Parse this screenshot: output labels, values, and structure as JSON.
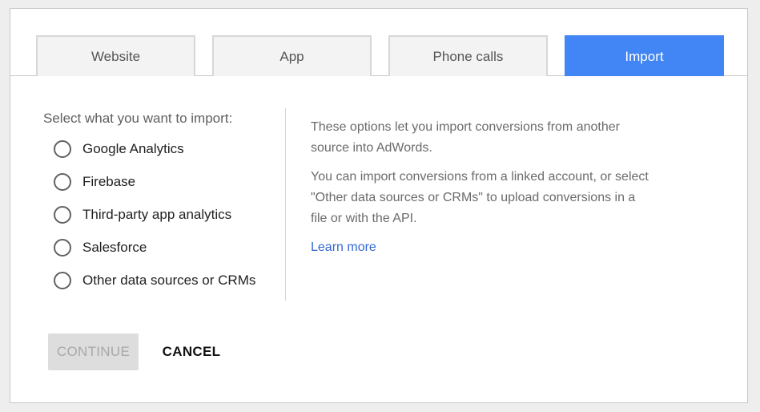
{
  "tabs": [
    {
      "label": "Website",
      "active": false
    },
    {
      "label": "App",
      "active": false
    },
    {
      "label": "Phone calls",
      "active": false
    },
    {
      "label": "Import",
      "active": true
    }
  ],
  "import_panel": {
    "prompt": "Select what you want to import:",
    "options": [
      {
        "label": "Google Analytics",
        "selected": false
      },
      {
        "label": "Firebase",
        "selected": false
      },
      {
        "label": "Third-party app analytics",
        "selected": false
      },
      {
        "label": "Salesforce",
        "selected": false
      },
      {
        "label": "Other data sources or CRMs",
        "selected": false
      }
    ]
  },
  "info": {
    "paragraph1": "These options let you import conversions from another source into AdWords.",
    "paragraph2": "You can import conversions from a linked account, or select \"Other data sources or CRMs\" to upload conversions in a file or with the API.",
    "learn_more": "Learn more"
  },
  "actions": {
    "continue_label": "CONTINUE",
    "continue_enabled": false,
    "cancel_label": "CANCEL"
  },
  "colors": {
    "active_tab": "#4285f4",
    "link": "#3367d6",
    "disabled_button": "#dddddd"
  }
}
